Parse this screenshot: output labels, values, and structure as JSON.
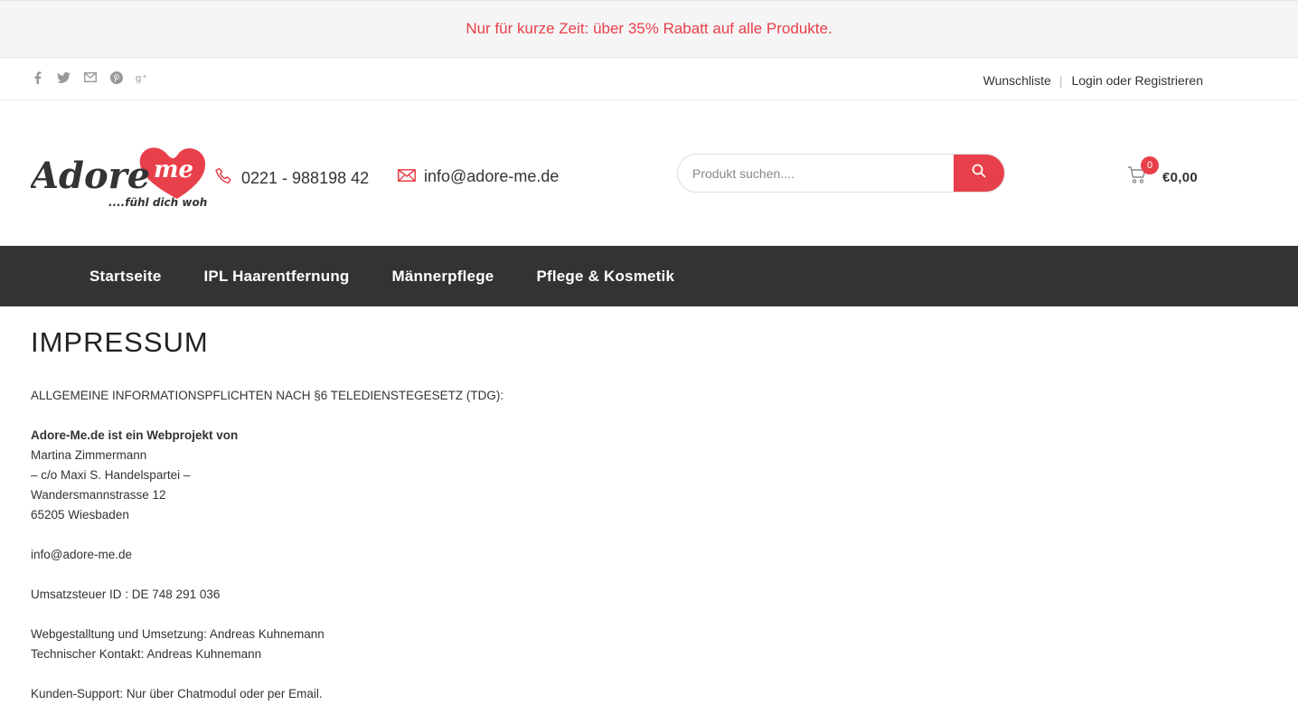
{
  "promo": {
    "text": "Nur für kurze Zeit: über 35% Rabatt auf alle Produkte."
  },
  "topbar": {
    "socials": [
      "facebook-icon",
      "twitter-icon",
      "mail-icon",
      "pinterest-icon",
      "google-plus-icon"
    ],
    "wishlist": "Wunschliste",
    "separator": "|",
    "login": "Login oder Registrieren"
  },
  "header": {
    "logo_text": "Adore",
    "logo_heart_text": "me",
    "logo_tagline": "....fühl dich wohl",
    "phone": "0221 - 988198 42",
    "email": "info@adore-me.de",
    "search_placeholder": "Produkt suchen....",
    "cart_count": "0",
    "cart_total": "€0,00"
  },
  "colors": {
    "accent": "#e8404a",
    "nav_bg": "#333333",
    "promo_bg": "#f5f5f5"
  },
  "nav": {
    "items": [
      "Startseite",
      "IPL Haarentfernung",
      "Männerpflege",
      "Pflege & Kosmetik"
    ]
  },
  "content": {
    "title": "IMPRESSUM",
    "info_heading": "ALLGEMEINE INFORMATIONSPFLICHTEN NACH §6 TELEDIENSTEGESETZ (TDG):",
    "webproject": "Adore-Me.de ist ein Webprojekt von",
    "name": "Martina Zimmermann",
    "co": "– c/o Maxi S. Handelspartei –",
    "street": "Wandersmannstrasse 12",
    "city": "65205 Wiesbaden",
    "email": "info@adore-me.de",
    "vat": "Umsatzsteuer ID : DE 748 291 036",
    "webdesign": "Webgestalltung und Umsetzung: Andreas Kuhnemann",
    "tech_contact": "Technischer Kontakt: Andreas Kuhnemann",
    "support": "Kunden-Support: Nur über Chatmodul oder per Email."
  }
}
